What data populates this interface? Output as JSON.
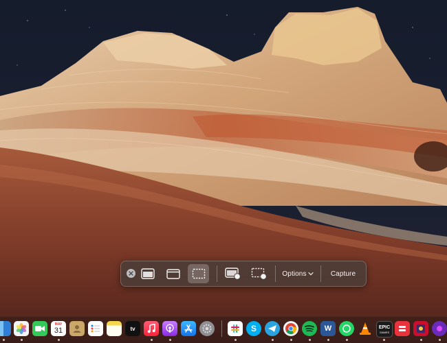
{
  "toolbar": {
    "close_label": "",
    "options_label": "Options",
    "capture_label": "Capture"
  },
  "dock": {
    "calendar_month": "MAY",
    "calendar_day": "31",
    "tv_label": "tv",
    "epic_label": "EPIC",
    "epic_sub": "GAMES",
    "skype_label": "S",
    "word_label": "W",
    "icons": [
      {
        "name": "finder-icon",
        "color": "#3f8fdc"
      },
      {
        "name": "photos-icon",
        "color": "#f2f2f2"
      },
      {
        "name": "facetime-icon",
        "color": "#34c759"
      },
      {
        "name": "calendar-icon",
        "color": "#ffffff"
      },
      {
        "name": "contacts-icon",
        "color": "#c9a86a"
      },
      {
        "name": "reminders-icon",
        "color": "#ffffff"
      },
      {
        "name": "notes-icon",
        "color": "#fde68a"
      },
      {
        "name": "apple-tv-icon",
        "color": "#111111"
      },
      {
        "name": "music-icon",
        "color": "#fa3c5a"
      },
      {
        "name": "podcasts-icon",
        "color": "#9b45d9"
      },
      {
        "name": "app-store-icon",
        "color": "#1e88f7"
      },
      {
        "name": "system-settings-icon",
        "color": "#8e8e93"
      },
      {
        "name": "slack-icon",
        "color": "#ffffff"
      },
      {
        "name": "skype-icon",
        "color": "#00aff0"
      },
      {
        "name": "telegram-icon",
        "color": "#2aa3df"
      },
      {
        "name": "chrome-icon",
        "color": "#ffffff"
      },
      {
        "name": "spotify-icon",
        "color": "#1db954"
      },
      {
        "name": "word-icon",
        "color": "#2b5797"
      },
      {
        "name": "whatsapp-icon",
        "color": "#25d366"
      },
      {
        "name": "vlc-icon",
        "color": "#ff8800"
      },
      {
        "name": "epic-games-icon",
        "color": "#1a1a1a"
      },
      {
        "name": "parallels-icon",
        "color": "#e8333c"
      },
      {
        "name": "photo-booth-icon",
        "color": "#c8102e"
      },
      {
        "name": "screen-capture-icon",
        "color": "#6b2bb8"
      }
    ]
  }
}
